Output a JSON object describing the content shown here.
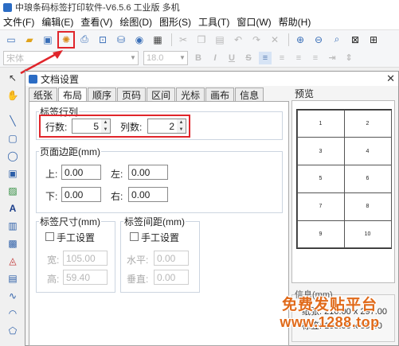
{
  "window": {
    "title": "中琅条码标签打印软件-V6.5.6 工业版 多机"
  },
  "menu": [
    "文件(F)",
    "编辑(E)",
    "查看(V)",
    "绘图(D)",
    "图形(S)",
    "工具(T)",
    "窗口(W)",
    "帮助(H)"
  ],
  "toolbar": {
    "icons": [
      "new-icon",
      "open-icon",
      "save-icon",
      "document-settings-icon",
      "print-icon",
      "print-preview-icon",
      "database-icon",
      "data-source-icon",
      "grid-icon",
      "cut-icon",
      "copy-icon",
      "paste-icon",
      "undo-icon",
      "redo-icon",
      "delete-icon",
      "zoom-in-icon",
      "zoom-out-icon",
      "zoom-fit-icon",
      "fit-page-icon",
      "snap-icon"
    ]
  },
  "format_bar": {
    "font": "宋体",
    "size": "18.0",
    "bold": "B",
    "italic": "I",
    "underline": "U",
    "strike": "S"
  },
  "dialog": {
    "title": "文档设置",
    "close": "✕",
    "tabs": [
      "纸张",
      "布局",
      "顺序",
      "页码",
      "区间",
      "光标",
      "画布",
      "信息"
    ],
    "active_tab": 1,
    "label_rows": {
      "group_title": "标签行列",
      "rows_label": "行数:",
      "rows_value": "5",
      "cols_label": "列数:",
      "cols_value": "2"
    },
    "margins": {
      "group_title": "页面边距(mm)",
      "top_label": "上:",
      "top_value": "0.00",
      "left_label": "左:",
      "left_value": "0.00",
      "bottom_label": "下:",
      "bottom_value": "0.00",
      "right_label": "右:",
      "right_value": "0.00"
    },
    "label_size": {
      "group_title": "标签尺寸(mm)",
      "manual_label": "手工设置",
      "width_label": "宽:",
      "width_value": "105.00",
      "height_label": "高:",
      "height_value": "59.40"
    },
    "label_spacing": {
      "group_title": "标签间距(mm)",
      "manual_label": "手工设置",
      "horizontal_label": "水平:",
      "horizontal_value": "0.00",
      "vertical_label": "垂直:",
      "vertical_value": "0.00"
    },
    "preview": {
      "title": "预览",
      "cells": [
        "1",
        "2",
        "3",
        "4",
        "5",
        "6",
        "7",
        "8",
        "9",
        "10"
      ]
    },
    "info": {
      "title": "信息(mm)",
      "paper": "纸张: 210.00 x 297.00",
      "label": "标签: 105.00 x 59.40"
    }
  },
  "watermark": {
    "line1": "免费发贴平台",
    "line2": "www.1288.top"
  }
}
